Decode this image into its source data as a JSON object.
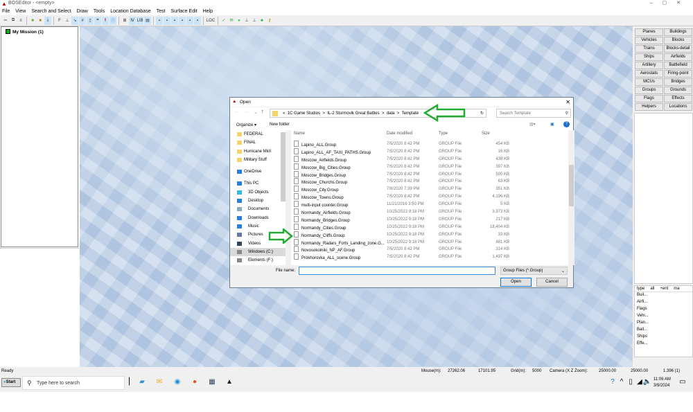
{
  "app": {
    "title": "BOSEditor - <empty>"
  },
  "menu": [
    "File",
    "View",
    "Search and Select",
    "Draw",
    "Tools",
    "Location Database",
    "Test",
    "Surface Edit",
    "Help"
  ],
  "toolbar": {
    "loc_label": "LOC",
    "lib_label": "LIB"
  },
  "tree": {
    "root": "My Mission (1)"
  },
  "right_buttons": [
    "Planes",
    "Buildings",
    "Vehicles",
    "Blocks",
    "Trains",
    "Blocks-detail",
    "Ships",
    "Airfields",
    "Artillery",
    "Battlefield",
    "Aerostats",
    "Firing-point",
    "MCUs",
    "Bridges",
    "Groups",
    "Grounds",
    "Flags",
    "Effects",
    "Helpers",
    "Locations"
  ],
  "right_list": {
    "headers": [
      "type",
      "all",
      "+ent",
      "ma"
    ],
    "items": [
      "Buil...",
      "Airfi...",
      "Flags",
      "Vehi...",
      "Plan...",
      "Ball...",
      "Ships",
      "Effe..."
    ]
  },
  "dialog": {
    "title": "Open",
    "breadcrumb": [
      "«",
      "1C Game Studios",
      ">",
      "IL-2 Sturmovik Great Battles",
      ">",
      "data",
      ">",
      "Template"
    ],
    "search_placeholder": "Search Template",
    "organize": "Organize ▾",
    "new_folder": "New folder",
    "nav": [
      "FEDERAL",
      "FINAL",
      "Hurricane MkII",
      "Military Stuff",
      "OneDrive",
      "This PC",
      "3D Objects",
      "Desktop",
      "Documents",
      "Downloads",
      "Music",
      "Pictures",
      "Videos",
      "Windows (C:)",
      "Elements (F:)"
    ],
    "columns": [
      "Name",
      "Date modified",
      "Type",
      "Size"
    ],
    "files": [
      [
        "Lapino_ALL.Group",
        "7/5/2020 8:42 PM",
        "GROUP File",
        "454 KB"
      ],
      [
        "Lapino_ALL_AF_TAXI_PATHS.Group",
        "7/5/2020 8:42 PM",
        "GROUP File",
        "16 KB"
      ],
      [
        "Moscow_Airfields.Group",
        "7/5/2020 8:42 PM",
        "GROUP File",
        "438 KB"
      ],
      [
        "Moscow_Big_Cities.Group",
        "7/5/2020 8:42 PM",
        "GROUP File",
        "397 KB"
      ],
      [
        "Moscow_Bridges.Group",
        "7/5/2020 8:42 PM",
        "GROUP File",
        "505 KB"
      ],
      [
        "Moscow_Churchs.Group",
        "7/5/2020 8:42 PM",
        "GROUP File",
        "63 KB"
      ],
      [
        "Moscow_City.Group",
        "7/8/2020 7:39 PM",
        "GROUP File",
        "351 KB"
      ],
      [
        "Moscow_Towns.Group",
        "7/5/2020 8:42 PM",
        "GROUP File",
        "4,196 KB"
      ],
      [
        "multi-input counter.Group",
        "11/21/2016 3:50 PM",
        "GROUP File",
        "5 KB"
      ],
      [
        "Normandy_Airfields.Group",
        "10/25/2022 9:18 PM",
        "GROUP File",
        "3,973 KB"
      ],
      [
        "Normandy_Bridges.Group",
        "10/25/2022 9:18 PM",
        "GROUP File",
        "217 KB"
      ],
      [
        "Normandy_Cities.Group",
        "10/25/2022 9:18 PM",
        "GROUP File",
        "18,404 KB"
      ],
      [
        "Normandy_Cliffs.Group",
        "10/25/2022 9:18 PM",
        "GROUP File",
        "33 KB"
      ],
      [
        "Normandy_Radars_Forts_Landing_zone.G...",
        "10/25/2022 9:18 PM",
        "GROUP File",
        "481 KB"
      ],
      [
        "Novosokolniki_NP_AF.Group",
        "7/5/2020 8:42 PM",
        "GROUP File",
        "314 KB"
      ],
      [
        "Prokhorovka_ALL_scene.Group",
        "7/5/2020 8:42 PM",
        "GROUP File",
        "1,497 KB"
      ]
    ],
    "file_name_label": "File name:",
    "file_name_value": "",
    "file_type": "Group Files (*.Group)",
    "open": "Open",
    "cancel": "Cancel"
  },
  "status": {
    "ready": "Ready",
    "mouse_label": "Mouse(m):",
    "mouse_x": "27262.06",
    "mouse_z": "17101.95",
    "grid_label": "Grid(m):",
    "grid": "5000",
    "camera_label": "Camera (X  Z  Zoom):",
    "cam_x": "25000.00",
    "cam_z": "25000.00",
    "cam_zoom": "1.396 (1)"
  },
  "taskbar": {
    "start": "Start",
    "search_placeholder": "Type here to search",
    "time": "11:06 AM",
    "date": "3/9/2024"
  },
  "colors": {
    "arrow": "#22aa33",
    "map": "#b9cde6",
    "accent": "#0078d7"
  }
}
